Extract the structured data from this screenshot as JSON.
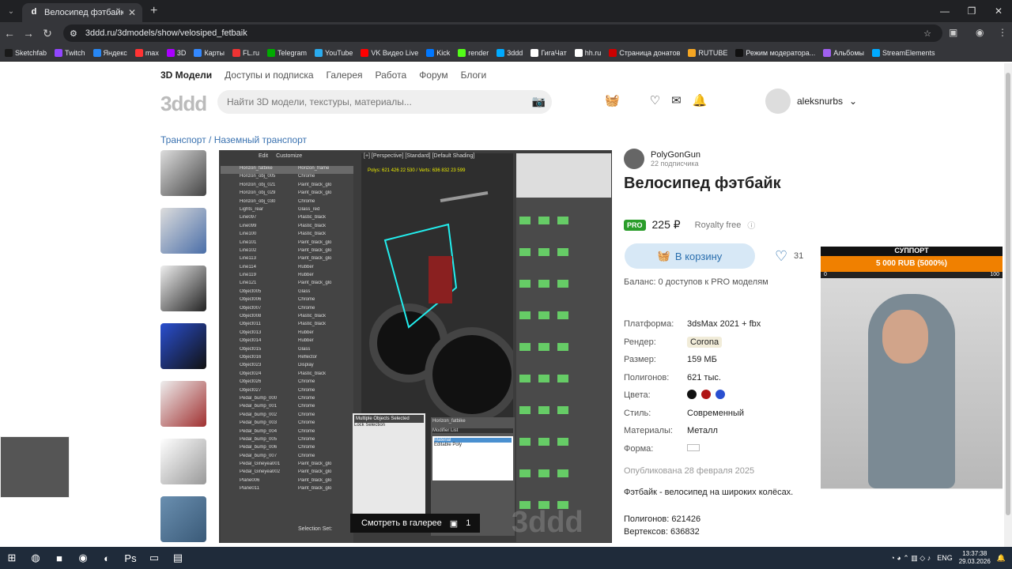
{
  "browser": {
    "tab_title": "Велосипед фэтбайк - Наземн",
    "url": "3ddd.ru/3dmodels/show/velosiped_fetbaik"
  },
  "bookmarks": [
    "Sketchfab",
    "Twitch",
    "Яндекс",
    "max",
    "3D",
    "Карты",
    "FL.ru",
    "Telegram",
    "YouTube",
    "VK Видео Live",
    "Kick",
    "render",
    "3ddd",
    "ГигаЧат",
    "hh.ru",
    "Страница донатов",
    "RUTUBE",
    "Режим модератора...",
    "Альбомы",
    "StreamElements"
  ],
  "site": {
    "menu": [
      "3D Модели",
      "Доступы и подписка",
      "Галерея",
      "Работа",
      "Форум",
      "Блоги"
    ],
    "logo": "3ddd",
    "search_placeholder": "Найти 3D модели, текстуры, материалы...",
    "username": "aleksnurbs",
    "breadcrumb": "Транспорт / Наземный транспорт"
  },
  "viewer": {
    "menu_items": [
      "Edit",
      "Customize"
    ],
    "viewport_header": "[+] [Perspective] [Standard] [Default Shading]",
    "stats": "Polys: 621 426 22 530 / Verts: 636 832 23 599",
    "gallery_btn": "Смотреть в галерее",
    "gallery_count": "1",
    "watermark": "3ddd",
    "outliner": [
      [
        "Horizon_fatbike",
        "Horizon_frame"
      ],
      [
        "Horizon_obj_005",
        "Chrome"
      ],
      [
        "Horizon_obj_021",
        "Paint_black_glo"
      ],
      [
        "Horizon_obj_029",
        "Paint_black_glo"
      ],
      [
        "Horizon_obj_030",
        "Chrome"
      ],
      [
        "Lights_rear",
        "Glass_red"
      ],
      [
        "Line097",
        "Plastic_black"
      ],
      [
        "Line099",
        "Plastic_black"
      ],
      [
        "Line100",
        "Plastic_black"
      ],
      [
        "Line101",
        "Paint_black_glo"
      ],
      [
        "Line102",
        "Paint_black_glo"
      ],
      [
        "Line113",
        "Paint_black_glo"
      ],
      [
        "Line114",
        "Rubber"
      ],
      [
        "Line119",
        "Rubber"
      ],
      [
        "Line121",
        "Paint_black_glo"
      ],
      [
        "Object005",
        "Glass"
      ],
      [
        "Object006",
        "Chrome"
      ],
      [
        "Object007",
        "Chrome"
      ],
      [
        "Object008",
        "Plastic_black"
      ],
      [
        "Object011",
        "Plastic_black"
      ],
      [
        "Object013",
        "Rubber"
      ],
      [
        "Object014",
        "Rubber"
      ],
      [
        "Object015",
        "Glass"
      ],
      [
        "Object016",
        "Reflector"
      ],
      [
        "Object023",
        "Display"
      ],
      [
        "Object024",
        "Plastic_black"
      ],
      [
        "Object026",
        "Chrome"
      ],
      [
        "Object027",
        "Chrome"
      ],
      [
        "Pedal_bump_000",
        "Chrome"
      ],
      [
        "Pedal_bump_001",
        "Chrome"
      ],
      [
        "Pedal_bump_002",
        "Chrome"
      ],
      [
        "Pedal_bump_003",
        "Chrome"
      ],
      [
        "Pedal_bump_004",
        "Chrome"
      ],
      [
        "Pedal_bump_005",
        "Chrome"
      ],
      [
        "Pedal_bump_006",
        "Chrome"
      ],
      [
        "Pedal_bump_007",
        "Chrome"
      ],
      [
        "Pedal_Gineyea001",
        "Paint_black_glo"
      ],
      [
        "Pedal_Gineyea002",
        "Paint_black_glo"
      ],
      [
        "Plane006",
        "Paint_black_glo"
      ],
      [
        "Plane011",
        "Paint_black_glo"
      ]
    ],
    "sel_title": "Multiple Objects Selected",
    "sel_lock": "Lock Selection",
    "modifier_title": "Horizon_fatbike",
    "modifier_list": "Modifier List",
    "mod1": "Material",
    "mod2": "Editable Poly",
    "selection_set": "Selection Set:"
  },
  "product": {
    "author": "PolyGonGun",
    "subscribers": "22 подписчика",
    "title": "Велосипед фэтбайк",
    "pro": "PRO",
    "price": "225 ₽",
    "royalty": "Royalty free",
    "cart": "В корзину",
    "likes": "31",
    "balance": "Баланс: 0 доступов к PRO моделям",
    "specs": [
      {
        "k": "Платформа:",
        "v": "3dsMax 2021 + fbx"
      },
      {
        "k": "Рендер:",
        "v": "Corona"
      },
      {
        "k": "Размер:",
        "v": "159 МБ"
      },
      {
        "k": "Полигонов:",
        "v": "621 тыс."
      },
      {
        "k": "Цвета:",
        "v": ""
      },
      {
        "k": "Стиль:",
        "v": "Современный"
      },
      {
        "k": "Материалы:",
        "v": "Металл"
      },
      {
        "k": "Форма:",
        "v": ""
      }
    ],
    "colors": [
      "#111111",
      "#b01515",
      "#2a4fd0"
    ],
    "published": "Опубликована 28 февраля 2025",
    "description": "Фэтбайк - велосипед на широких колёсах.",
    "polygons": "Полигонов: 621426",
    "vertices": "Вертексов: 636832"
  },
  "stream": {
    "header": "СУППОРТ",
    "goal": "5 000 RUB (5000%)",
    "min": "0",
    "max": "100"
  },
  "taskbar": {
    "lang": "ENG",
    "time": "13:37:38",
    "date": "29.03.2026"
  }
}
